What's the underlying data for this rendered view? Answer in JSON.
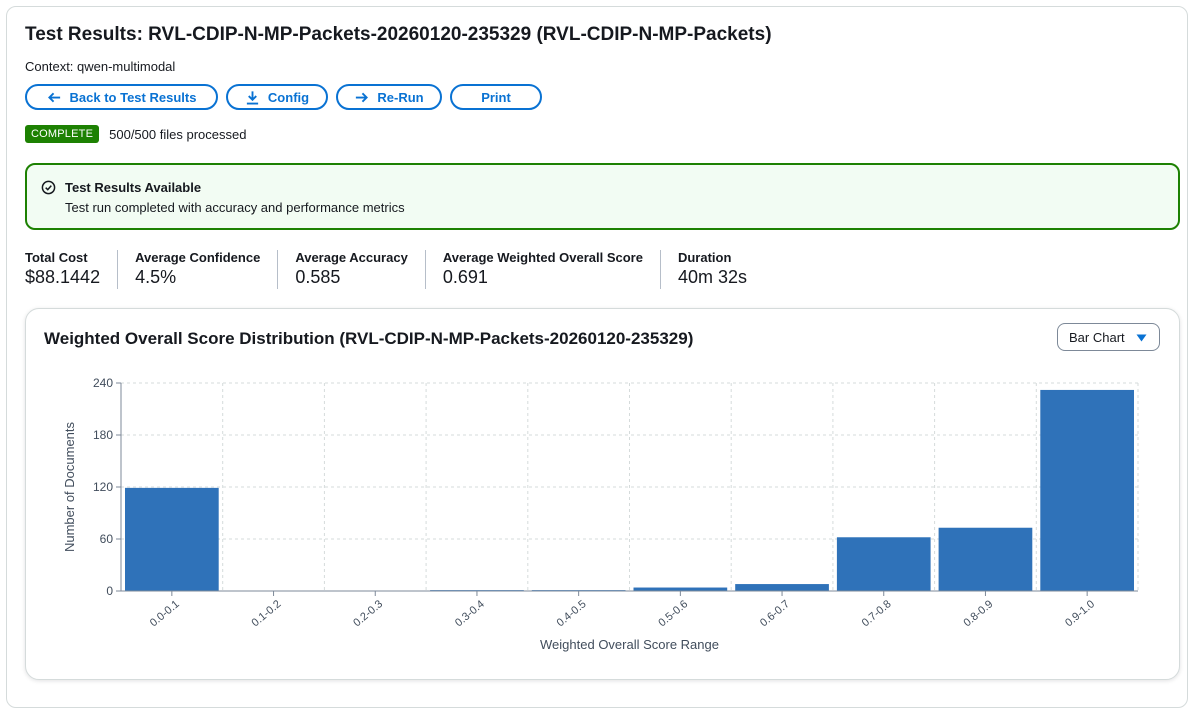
{
  "header": {
    "title": "Test Results: RVL-CDIP-N-MP-Packets-20260120-235329 (RVL-CDIP-N-MP-Packets)",
    "context": "Context: qwen-multimodal"
  },
  "buttons": {
    "back": "Back to Test Results",
    "config": "Config",
    "rerun": "Re-Run",
    "print": "Print"
  },
  "status": {
    "badge": "COMPLETE",
    "text": "500/500 files processed",
    "badge_color": "#1d8102"
  },
  "alert": {
    "title": "Test Results Available",
    "text": "Test run completed with accuracy and performance metrics"
  },
  "metrics": [
    {
      "label": "Total Cost",
      "value": "$88.1442"
    },
    {
      "label": "Average Confidence",
      "value": "4.5%"
    },
    {
      "label": "Average Accuracy",
      "value": "0.585"
    },
    {
      "label": "Average Weighted Overall Score",
      "value": "0.691"
    },
    {
      "label": "Duration",
      "value": "40m 32s"
    }
  ],
  "panel": {
    "title": "Weighted Overall Score Distribution (RVL-CDIP-N-MP-Packets-20260120-235329)",
    "select_value": "Bar Chart"
  },
  "chart_data": {
    "type": "bar",
    "categories": [
      "0.0-0.1",
      "0.1-0.2",
      "0.2-0.3",
      "0.3-0.4",
      "0.4-0.5",
      "0.5-0.6",
      "0.6-0.7",
      "0.7-0.8",
      "0.8-0.9",
      "0.9-1.0"
    ],
    "values": [
      119,
      0,
      0,
      1,
      1,
      4,
      8,
      62,
      73,
      232
    ],
    "xlabel": "Weighted Overall Score Range",
    "ylabel": "Number of Documents",
    "ylim": [
      0,
      240
    ],
    "yticks": [
      0,
      60,
      120,
      180,
      240
    ],
    "grid": true,
    "bar_color": "#2f72b9"
  },
  "colors": {
    "accent": "#0972d3",
    "success": "#1d8102"
  }
}
